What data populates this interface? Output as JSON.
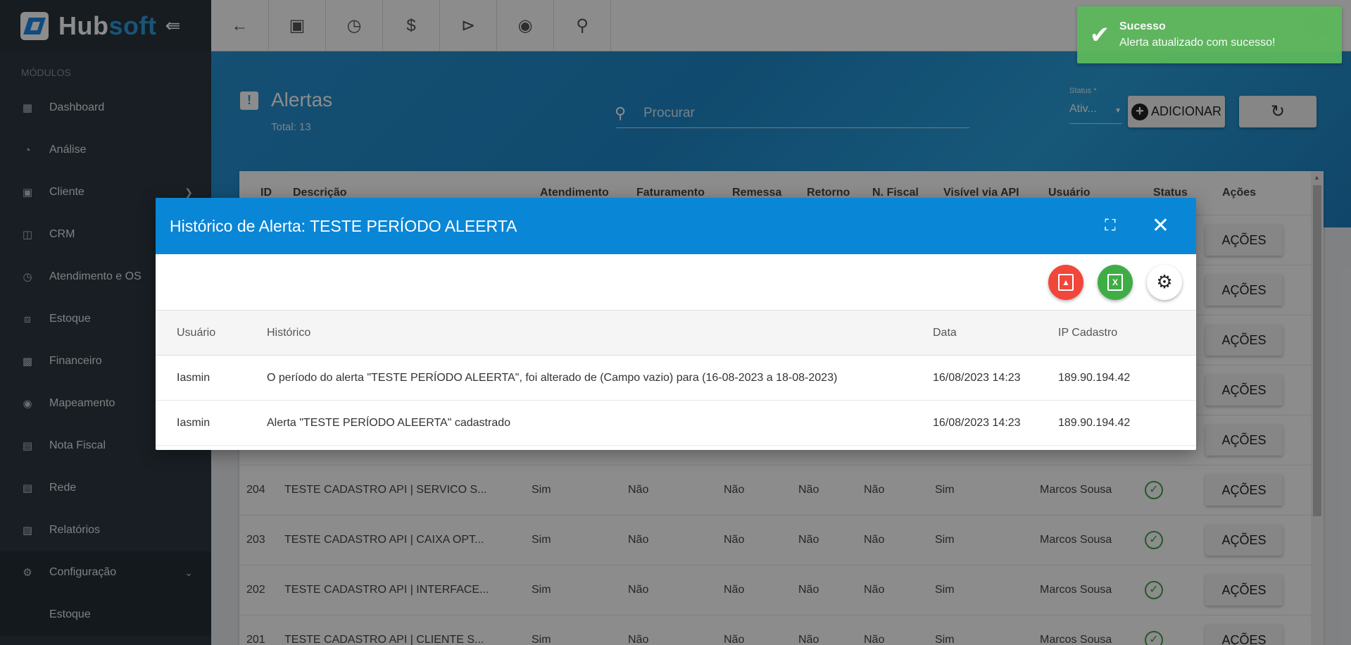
{
  "app": {
    "logo_hub": "Hub",
    "logo_soft": "soft"
  },
  "sidebar": {
    "section_label": "MÓDULOS",
    "items": [
      {
        "label": "Dashboard",
        "icon": "grid-icon"
      },
      {
        "label": "Análise",
        "icon": "pie-chart-icon"
      },
      {
        "label": "Cliente",
        "icon": "contact-card-icon"
      },
      {
        "label": "CRM",
        "icon": "board-icon"
      },
      {
        "label": "Atendimento e OS",
        "icon": "calendar-clock-icon"
      },
      {
        "label": "Estoque",
        "icon": "box-icon"
      },
      {
        "label": "Financeiro",
        "icon": "money-icon"
      },
      {
        "label": "Mapeamento",
        "icon": "map-pin-icon"
      },
      {
        "label": "Nota Fiscal",
        "icon": "document-list-icon"
      },
      {
        "label": "Rede",
        "icon": "server-icon"
      },
      {
        "label": "Relatórios",
        "icon": "report-icon"
      },
      {
        "label": "Configuração",
        "icon": "gear-icon"
      }
    ],
    "sub_items": [
      {
        "label": "Estoque"
      }
    ]
  },
  "header": {
    "title": "Alertas",
    "total": "Total: 13",
    "search_placeholder": "Procurar",
    "status_label": "Status *",
    "status_value": "Ativ...",
    "add_label": "ADICIONAR"
  },
  "table": {
    "columns": [
      "ID",
      "Descrição",
      "Atendimento",
      "Faturamento",
      "Remessa",
      "Retorno",
      "N. Fiscal",
      "Visível via API",
      "Usuário",
      "Status",
      "Ações"
    ],
    "action_label": "AÇÕES",
    "rows": [
      {
        "id": "",
        "desc": "",
        "atend": "",
        "fat": "",
        "rem": "",
        "ret": "",
        "nf": "",
        "api": "",
        "user": ""
      },
      {
        "id": "",
        "desc": "",
        "atend": "",
        "fat": "",
        "rem": "",
        "ret": "",
        "nf": "",
        "api": "",
        "user": ""
      },
      {
        "id": "",
        "desc": "",
        "atend": "",
        "fat": "",
        "rem": "",
        "ret": "",
        "nf": "",
        "api": "",
        "user": ""
      },
      {
        "id": "",
        "desc": "",
        "atend": "",
        "fat": "",
        "rem": "",
        "ret": "",
        "nf": "",
        "api": "",
        "user": ""
      },
      {
        "id": "",
        "desc": "",
        "atend": "",
        "fat": "",
        "rem": "",
        "ret": "",
        "nf": "",
        "api": "",
        "user": ""
      },
      {
        "id": "204",
        "desc": "TESTE CADASTRO API | SERVICO S...",
        "atend": "Sim",
        "fat": "Não",
        "rem": "Não",
        "ret": "Não",
        "nf": "Não",
        "api": "Sim",
        "user": "Marcos Sousa"
      },
      {
        "id": "203",
        "desc": "TESTE CADASTRO API | CAIXA OPT...",
        "atend": "Sim",
        "fat": "Não",
        "rem": "Não",
        "ret": "Não",
        "nf": "Não",
        "api": "Sim",
        "user": "Marcos Sousa"
      },
      {
        "id": "202",
        "desc": "TESTE CADASTRO API | INTERFACE...",
        "atend": "Sim",
        "fat": "Não",
        "rem": "Não",
        "ret": "Não",
        "nf": "Não",
        "api": "Sim",
        "user": "Marcos Sousa"
      },
      {
        "id": "201",
        "desc": "TESTE CADASTRO API | CLIENTE S...",
        "atend": "Sim",
        "fat": "Não",
        "rem": "Não",
        "ret": "Não",
        "nf": "Não",
        "api": "Sim",
        "user": "Marcos Sousa"
      }
    ]
  },
  "dialog": {
    "title": "Histórico de Alerta: TESTE PERÍODO ALEERTA",
    "xls_glyph": "X",
    "columns": [
      "Usuário",
      "Histórico",
      "Data",
      "IP Cadastro"
    ],
    "rows": [
      {
        "user": "Iasmin",
        "hist": "O período do alerta \"TESTE PERÍODO ALEERTA\", foi alterado de (Campo vazio) para (16-08-2023 a 18-08-2023)",
        "data": "16/08/2023 14:23",
        "ip": "189.90.194.42"
      },
      {
        "user": "Iasmin",
        "hist": "Alerta \"TESTE PERÍODO ALEERTA\" cadastrado",
        "data": "16/08/2023 14:23",
        "ip": "189.90.194.42"
      }
    ]
  },
  "toast": {
    "title": "Sucesso",
    "message": "Alerta atualizado com sucesso!"
  },
  "colors": {
    "primary": "#0a86d6",
    "success": "#5cb85c",
    "sidebar": "#2d3741",
    "pdf": "#f2463b",
    "excel": "#3fad46"
  }
}
